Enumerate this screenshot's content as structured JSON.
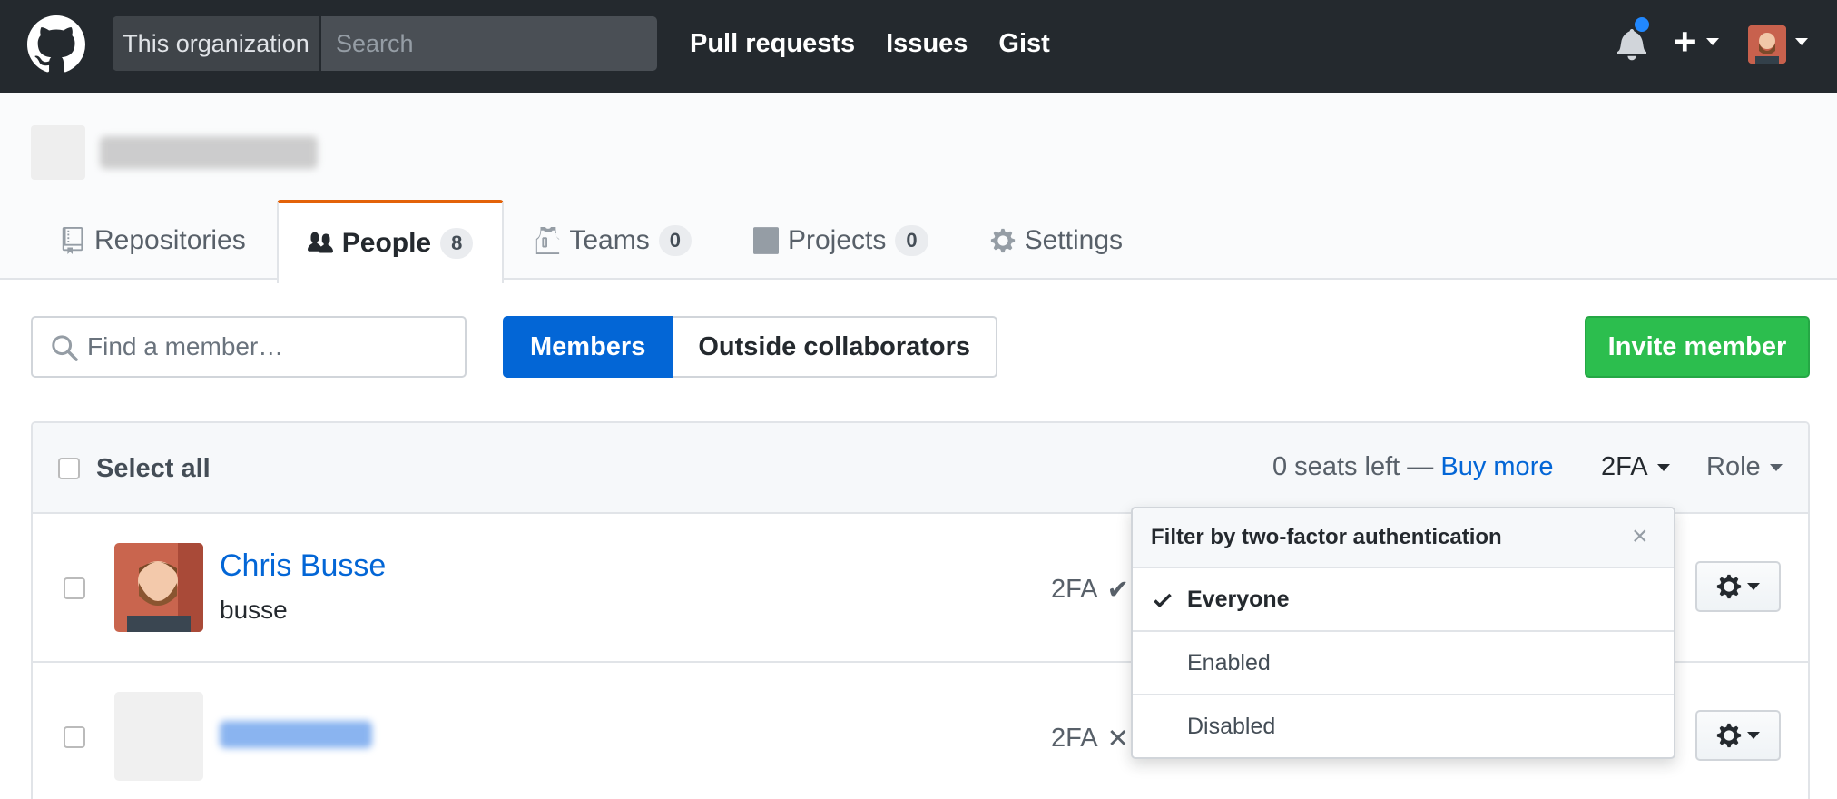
{
  "header": {
    "search_scope": "This organization",
    "search_placeholder": "Search",
    "nav": [
      "Pull requests",
      "Issues",
      "Gist"
    ]
  },
  "tabs": [
    {
      "label": "Repositories",
      "count": null
    },
    {
      "label": "People",
      "count": "8"
    },
    {
      "label": "Teams",
      "count": "0"
    },
    {
      "label": "Projects",
      "count": "0"
    },
    {
      "label": "Settings",
      "count": null
    }
  ],
  "toolbar": {
    "find_placeholder": "Find a member…",
    "segment_members": "Members",
    "segment_outside": "Outside collaborators",
    "invite_label": "Invite member"
  },
  "table_header": {
    "select_all": "Select all",
    "seats_text": "0 seats left —",
    "buy_more": "Buy more",
    "filter_2fa": "2FA",
    "filter_role": "Role"
  },
  "members": [
    {
      "name": "Chris Busse",
      "login": "busse",
      "twofa_label": "2FA",
      "twofa_status": "✔"
    },
    {
      "name": "",
      "login": "",
      "twofa_label": "2FA",
      "twofa_status": "✕"
    }
  ],
  "dropdown": {
    "title": "Filter by two-factor authentication",
    "close": "×",
    "items": [
      "Everyone",
      "Enabled",
      "Disabled"
    ],
    "selected": "Everyone"
  },
  "colors": {
    "topbar": "#24292e",
    "accent_blue": "#0366d6",
    "green": "#2cbe4e",
    "tab_orange": "#e36209",
    "notification_dot": "#2188ff"
  }
}
